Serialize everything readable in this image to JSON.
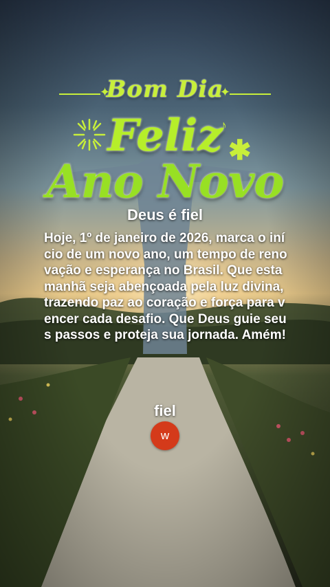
{
  "card": {
    "greeting_top": "Bom Dia",
    "greeting_line1": "Feliz",
    "greeting_line2": "Ano Novo",
    "subtitle": "Deus é fiel",
    "message": "Hoje, 1º de janeiro de 2026, marca o início de um novo ano, um tempo de renovação e esperança no Brasil. Que esta manhã seja abençoada pela luz divina, trazendo paz ao coração e força para vencer cada desafio. Que Deus guie seus passos e proteja sua jornada. Amém!",
    "author": "fiel",
    "avatar_letter": "w"
  },
  "icons": {
    "firework": "firework-icon",
    "asterisk": "asterisk-icon",
    "note": "music-note-icon",
    "spark": "sparkle-icon"
  },
  "colors": {
    "greeting_green": "#b6ee2a",
    "avatar_red": "#d43a1a",
    "text_white": "#ffffff"
  }
}
